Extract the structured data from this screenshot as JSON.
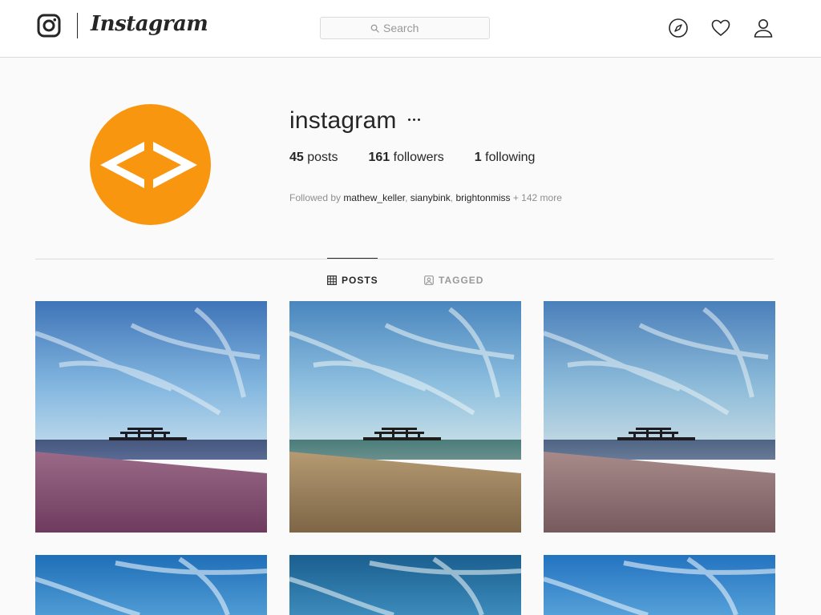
{
  "header": {
    "brand": "Instagram",
    "search_placeholder": "Search",
    "icons": [
      "instagram-logo-icon",
      "search-icon",
      "compass-icon",
      "heart-icon",
      "user-icon"
    ]
  },
  "profile": {
    "username": "instagram",
    "more_label": "···",
    "stats": {
      "posts_count": "45",
      "posts_label": "posts",
      "followers_count": "161",
      "followers_label": "followers",
      "following_count": "1",
      "following_label": "following"
    },
    "followed_by": {
      "prefix": "Followed by",
      "accounts": [
        "mathew_keller",
        "sianybink",
        "brightonmiss"
      ],
      "suffix": "+ 142 more"
    },
    "avatar_color": "#f9960f"
  },
  "tabs": [
    {
      "label": "POSTS",
      "icon": "grid-icon",
      "active": true
    },
    {
      "label": "TAGGED",
      "icon": "tagged-icon",
      "active": false
    }
  ],
  "posts": [
    {
      "filter": "purple-beach"
    },
    {
      "filter": "warm-beach"
    },
    {
      "filter": "faded-beach"
    },
    {
      "filter": "bright-sky"
    },
    {
      "filter": "deep-sky"
    },
    {
      "filter": "bright-sky"
    }
  ],
  "colors": {
    "background": "#fafafa",
    "text": "#262626",
    "muted": "#8e8e8e",
    "border": "#dbdbdb",
    "brand_orange": "#f9960f"
  }
}
